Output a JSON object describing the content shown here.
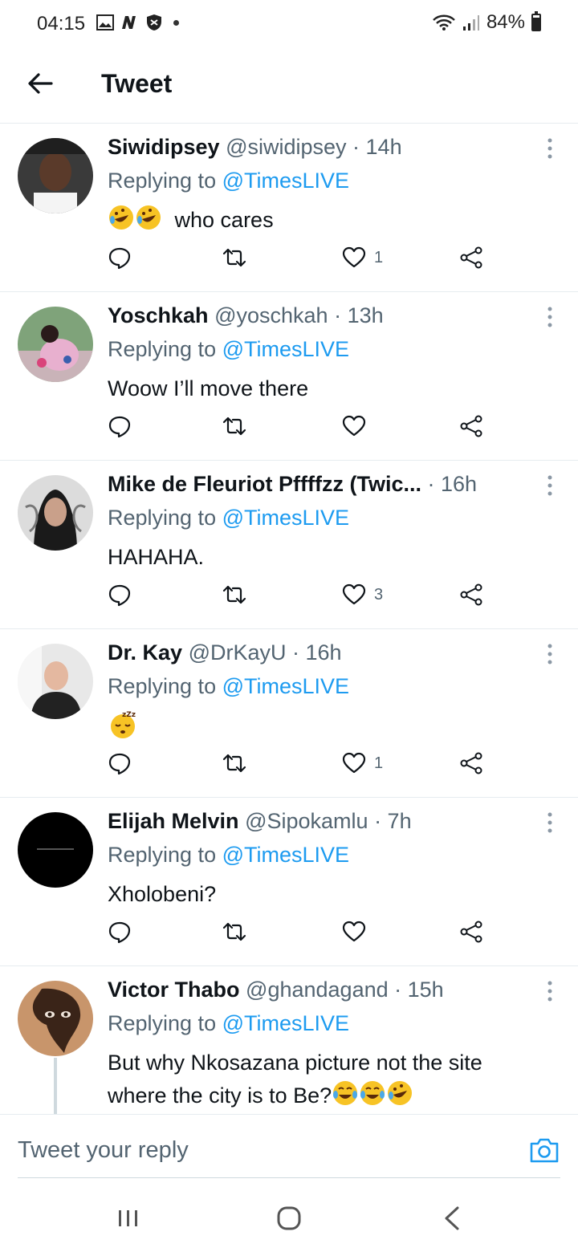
{
  "status": {
    "time": "04:15",
    "battery": "84%"
  },
  "header": {
    "title": "Tweet"
  },
  "tweets": [
    {
      "name": "Siwidipsey",
      "handle": "@siwidipsey",
      "time": "· 14h",
      "replying_prefix": "Replying to ",
      "mention": "@TimesLIVE",
      "text": "who cares",
      "likes": "1",
      "avatar": "#4a4a4a"
    },
    {
      "name": "Yoschkah",
      "handle": "@yoschkah",
      "time": "· 13h",
      "replying_prefix": "Replying to ",
      "mention": "@TimesLIVE",
      "text": "Woow I’ll move there",
      "likes": "",
      "avatar": "#b89a8a"
    },
    {
      "name": "Mike de Fleuriot Pffffzz (Twic...",
      "handle": "",
      "time": "· 16h",
      "replying_prefix": "Replying to ",
      "mention": "@TimesLIVE",
      "text": "HAHAHA.",
      "likes": "3",
      "avatar": "#2c2c2c"
    },
    {
      "name": "Dr. Kay",
      "handle": "@DrKayU",
      "time": "· 16h",
      "replying_prefix": "Replying to ",
      "mention": "@TimesLIVE",
      "text": "",
      "likes": "1",
      "avatar": "#d8d8d8"
    },
    {
      "name": "Elijah Melvin",
      "handle": "@Sipokamlu",
      "time": "· 7h",
      "replying_prefix": "Replying to ",
      "mention": "@TimesLIVE",
      "text": "Xholobeni?",
      "likes": "",
      "avatar": "#000000"
    },
    {
      "name": "Victor Thabo",
      "handle": "@ghandagand",
      "time": "· 15h",
      "replying_prefix": "Replying to ",
      "mention": "@TimesLIVE",
      "text": "But why Nkosazana picture not the site where the city is to Be?",
      "likes": "",
      "avatar": "#a0683e"
    }
  ],
  "reply_bar": {
    "placeholder": "Tweet your reply"
  },
  "colors": {
    "accent": "#1d9bf0",
    "secondary_text": "#536471",
    "divider": "#e6ecf0"
  }
}
